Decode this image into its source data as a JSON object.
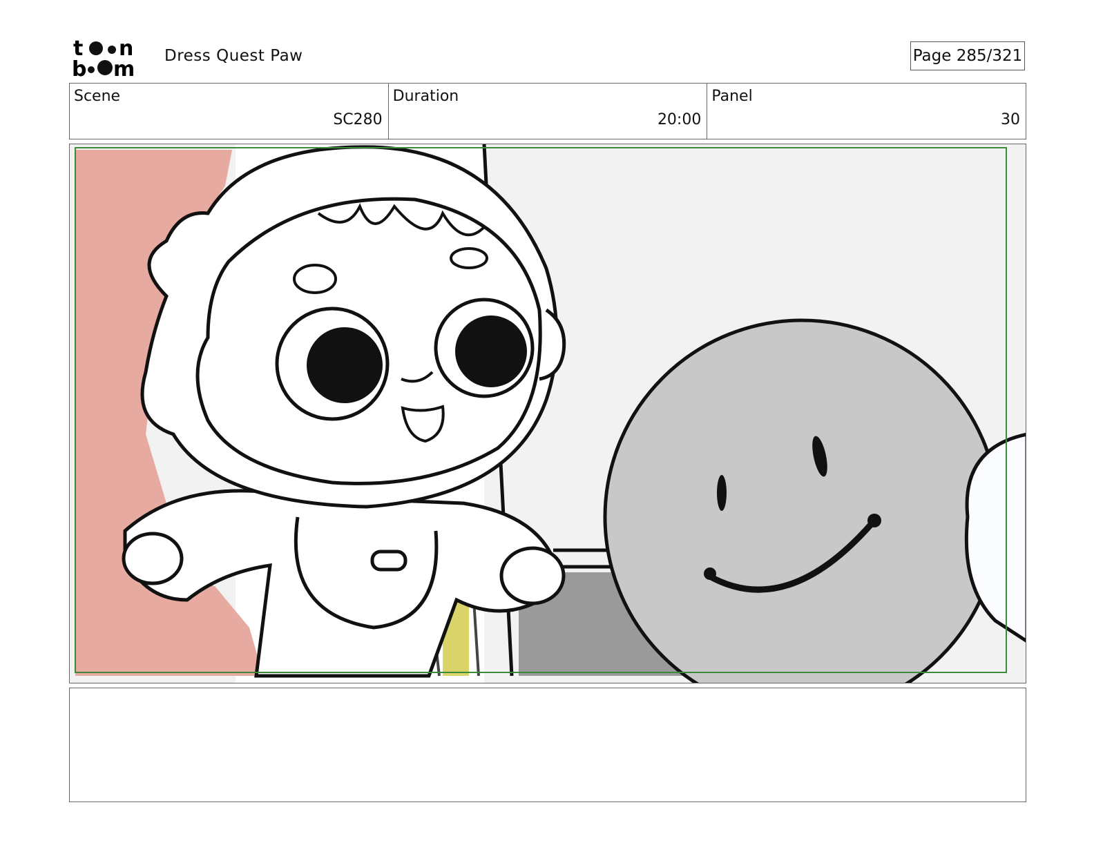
{
  "header": {
    "logo_top": "to n",
    "logo_bottom": "b  m",
    "project_title": "Dress Quest Paw",
    "page_label": "Page 285/321"
  },
  "info": {
    "scene_label": "Scene",
    "scene_value": "SC280",
    "duration_label": "Duration",
    "duration_value": "20:00",
    "panel_label": "Panel",
    "panel_value": "30"
  },
  "colors": {
    "safe_frame": "#3a8a3a",
    "pink_bg": "#e6aaa0",
    "smiley_fill": "#c8c8c8",
    "wall": "#f2f2f2",
    "dark_floor": "#9a9a9a",
    "yellow_accent": "#d9d36a"
  }
}
